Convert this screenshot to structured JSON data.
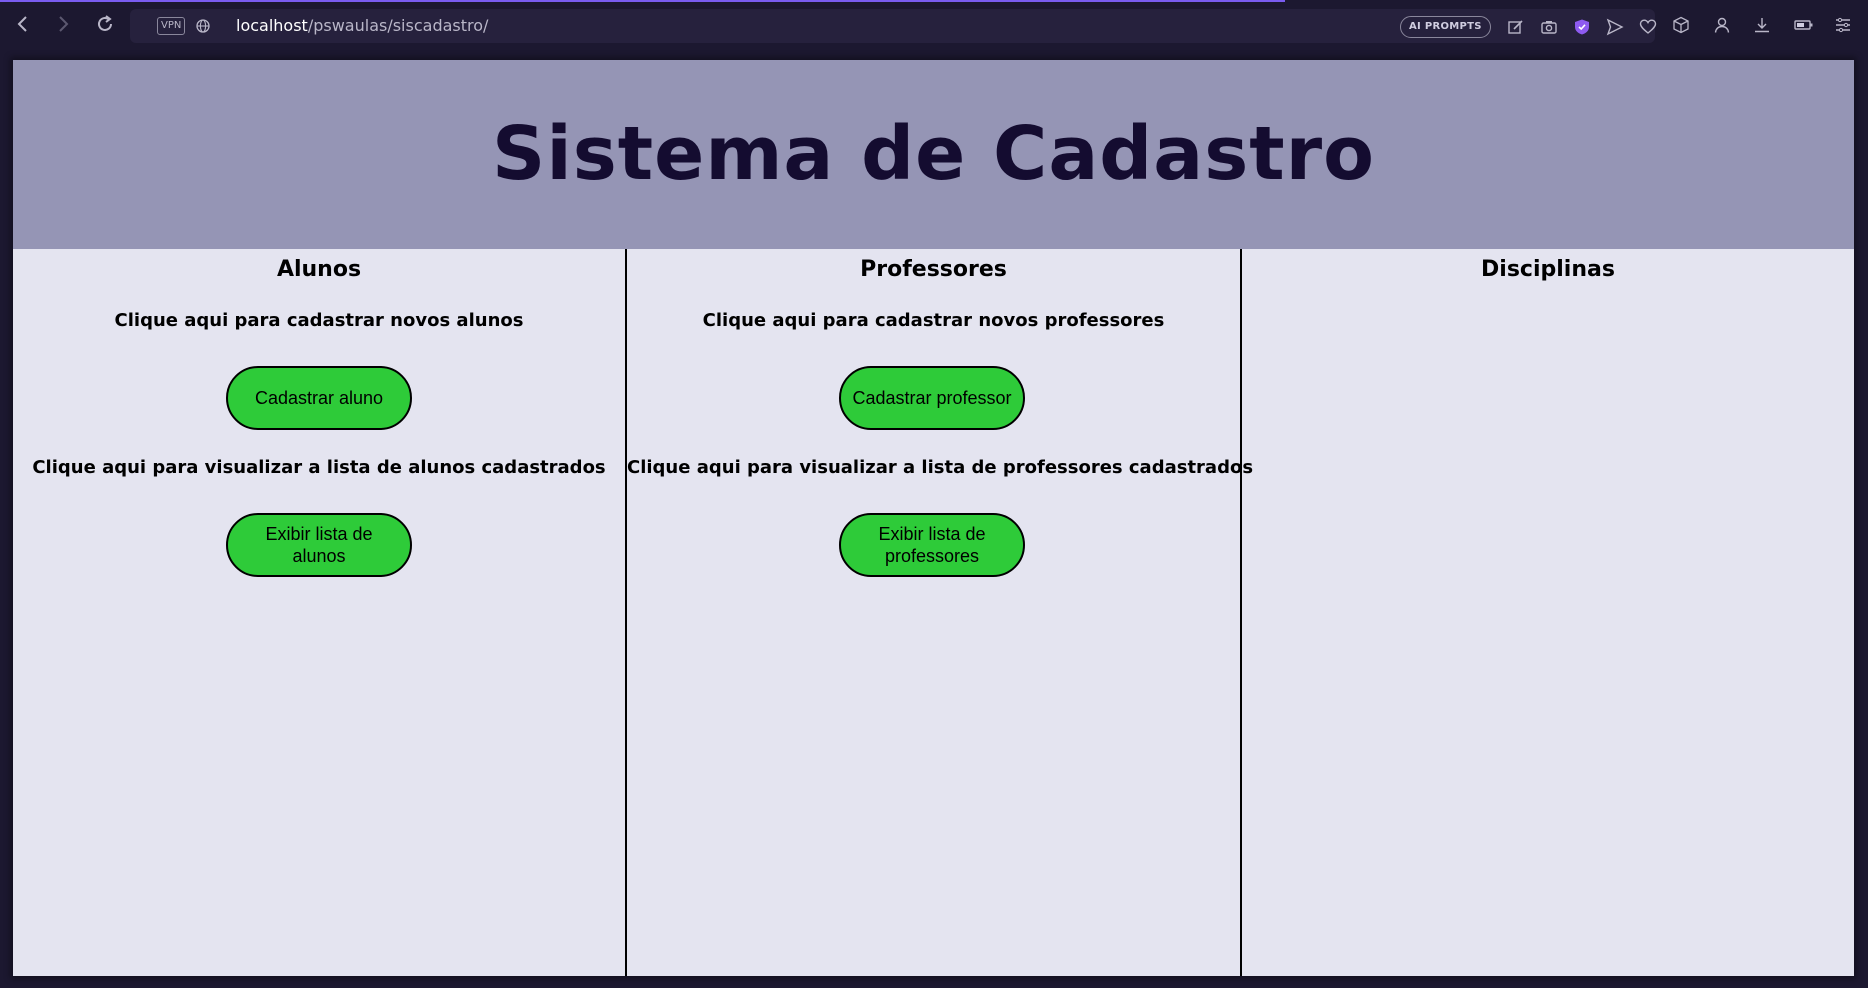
{
  "browser": {
    "url_host": "localhost",
    "url_path": "/pswaulas/siscadastro/",
    "vpn_label": "VPN",
    "ai_prompts_label": "AI PROMPTS",
    "icons": [
      "back-icon",
      "forward-icon",
      "reload-icon",
      "globe-icon",
      "edit-icon",
      "camera-icon",
      "shield-icon",
      "send-icon",
      "heart-icon",
      "cube-icon",
      "profile-icon",
      "download-icon",
      "battery-icon",
      "menu-icon"
    ],
    "accent_color": "#7a5cf0"
  },
  "page": {
    "title": "Sistema de Cadastro",
    "header_color": "#9595b5",
    "background_color": "#e4e4f0",
    "button_color": "#2ecb39",
    "columns": [
      {
        "title": "Alunos",
        "register_text": "Clique aqui para cadastrar novos alunos",
        "register_button": "Cadastrar aluno",
        "list_text": "Clique aqui para visualizar a lista de alunos cadastrados",
        "list_button": "Exibir lista de alunos"
      },
      {
        "title": "Professores",
        "register_text": "Clique aqui para cadastrar novos professores",
        "register_button": "Cadastrar professor",
        "list_text": "Clique aqui para visualizar a lista de professores cadastrados",
        "list_button": "Exibir lista de professores"
      },
      {
        "title": "Disciplinas"
      }
    ]
  }
}
